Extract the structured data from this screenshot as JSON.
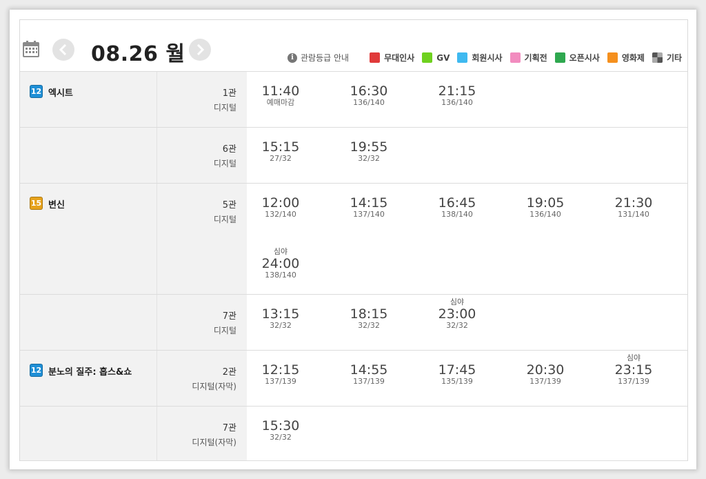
{
  "header": {
    "date": "08.26 월",
    "guide_label": "관람등급 안내",
    "guide_icon": "i"
  },
  "legend": [
    {
      "label": "무대인사",
      "color": "#e03a3a"
    },
    {
      "label": "GV",
      "color": "#6fd11f"
    },
    {
      "label": "회원시사",
      "color": "#3fb9f0"
    },
    {
      "label": "기획전",
      "color": "#f28cbf"
    },
    {
      "label": "오픈시사",
      "color": "#2fa84f"
    },
    {
      "label": "영화제",
      "color": "#f5901e"
    },
    {
      "label": "기타",
      "color": "#666666"
    }
  ],
  "rows": [
    {
      "rating": "12",
      "rating_color": "#1f8fd6",
      "title": "엑시트",
      "hall": "1관",
      "type": "디지털",
      "slots": [
        {
          "late": "",
          "time": "11:40",
          "seats": "예매마감"
        },
        {
          "late": "",
          "time": "16:30",
          "seats": "136/140"
        },
        {
          "late": "",
          "time": "21:15",
          "seats": "136/140"
        }
      ]
    },
    {
      "rating": "",
      "title": "",
      "hall": "6관",
      "type": "디지털",
      "slots": [
        {
          "late": "",
          "time": "15:15",
          "seats": "27/32"
        },
        {
          "late": "",
          "time": "19:55",
          "seats": "32/32"
        }
      ]
    },
    {
      "rating": "15",
      "rating_color": "#e6a21c",
      "title": "변신",
      "hall": "5관",
      "type": "디지털",
      "slots": [
        {
          "late": "",
          "time": "12:00",
          "seats": "132/140"
        },
        {
          "late": "",
          "time": "14:15",
          "seats": "137/140"
        },
        {
          "late": "",
          "time": "16:45",
          "seats": "138/140"
        },
        {
          "late": "",
          "time": "19:05",
          "seats": "136/140"
        },
        {
          "late": "",
          "time": "21:30",
          "seats": "131/140"
        },
        {
          "late": "심야",
          "time": "24:00",
          "seats": "138/140"
        }
      ]
    },
    {
      "rating": "",
      "title": "",
      "hall": "7관",
      "type": "디지털",
      "slots": [
        {
          "late": "",
          "time": "13:15",
          "seats": "32/32"
        },
        {
          "late": "",
          "time": "18:15",
          "seats": "32/32"
        },
        {
          "late": "심야",
          "time": "23:00",
          "seats": "32/32"
        }
      ]
    },
    {
      "rating": "12",
      "rating_color": "#1f8fd6",
      "title": "분노의 질주: 홉스&쇼",
      "hall": "2관",
      "type": "디지털(자막)",
      "slots": [
        {
          "late": "",
          "time": "12:15",
          "seats": "137/139"
        },
        {
          "late": "",
          "time": "14:55",
          "seats": "137/139"
        },
        {
          "late": "",
          "time": "17:45",
          "seats": "135/139"
        },
        {
          "late": "",
          "time": "20:30",
          "seats": "137/139"
        },
        {
          "late": "심야",
          "time": "23:15",
          "seats": "137/139"
        }
      ]
    },
    {
      "rating": "",
      "title": "",
      "hall": "7관",
      "type": "디지털(자막)",
      "slots": [
        {
          "late": "",
          "time": "15:30",
          "seats": "32/32"
        }
      ]
    }
  ]
}
